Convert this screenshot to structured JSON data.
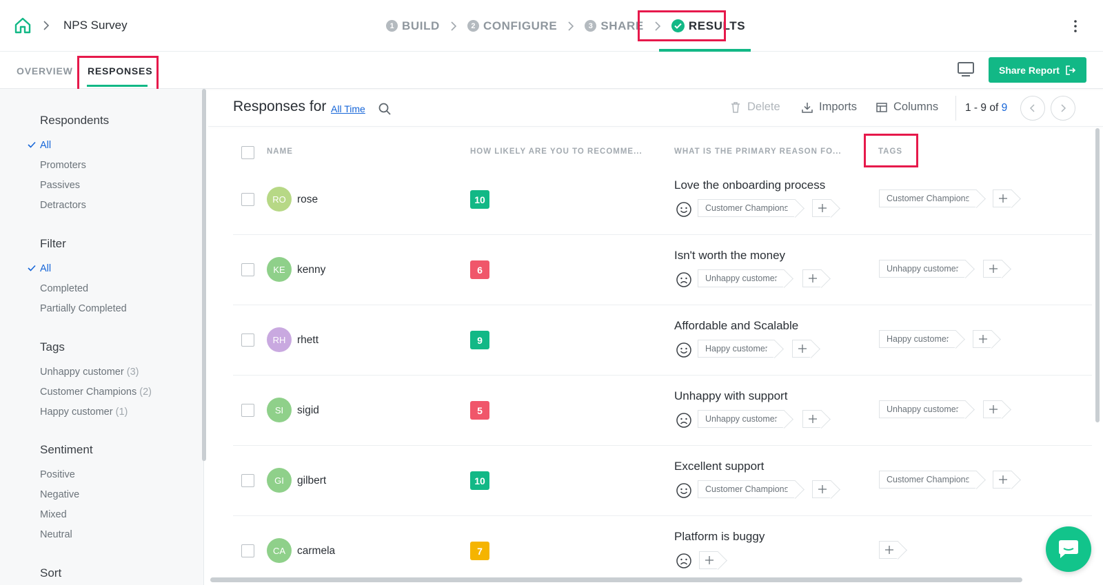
{
  "header": {
    "survey_title": "NPS Survey",
    "steps": [
      {
        "num": "1",
        "label": "BUILD"
      },
      {
        "num": "2",
        "label": "CONFIGURE"
      },
      {
        "num": "3",
        "label": "SHARE"
      },
      {
        "num": "",
        "label": "RESULTS"
      }
    ]
  },
  "subnav": {
    "tabs": [
      "OVERVIEW",
      "RESPONSES"
    ],
    "share_label": "Share Report"
  },
  "sidebar": {
    "respondents": {
      "title": "Respondents",
      "items": [
        "All",
        "Promoters",
        "Passives",
        "Detractors"
      ]
    },
    "filter": {
      "title": "Filter",
      "items": [
        "All",
        "Completed",
        "Partially Completed"
      ]
    },
    "tags": {
      "title": "Tags",
      "items": [
        {
          "label": "Unhappy customer",
          "count": "(3)"
        },
        {
          "label": "Customer Champions",
          "count": "(2)"
        },
        {
          "label": "Happy customer",
          "count": "(1)"
        }
      ]
    },
    "sentiment": {
      "title": "Sentiment",
      "items": [
        "Positive",
        "Negative",
        "Mixed",
        "Neutral"
      ]
    },
    "sort": {
      "title": "Sort"
    }
  },
  "main": {
    "title": "Responses for",
    "range_link": "All Time",
    "toolbar": {
      "delete": "Delete",
      "imports": "Imports",
      "columns": "Columns"
    },
    "pager": {
      "range": "1 - 9 of ",
      "total": "9"
    },
    "columns": [
      "NAME",
      "HOW LIKELY ARE YOU TO RECOMME...",
      "WHAT IS THE PRIMARY REASON FO...",
      "TAGS"
    ],
    "rows": [
      {
        "initials": "RO",
        "name": "rose",
        "score": "10",
        "reason": "Love the onboarding process",
        "reason_tag": "Customer Champions",
        "tag": "Customer Champions"
      },
      {
        "initials": "KE",
        "name": "kenny",
        "score": "6",
        "reason": "Isn't worth the money",
        "reason_tag": "Unhappy customer",
        "tag": "Unhappy customer"
      },
      {
        "initials": "RH",
        "name": "rhett",
        "score": "9",
        "reason": "Affordable and Scalable",
        "reason_tag": "Happy customer",
        "tag": "Happy customer"
      },
      {
        "initials": "SI",
        "name": "sigid",
        "score": "5",
        "reason": "Unhappy with support",
        "reason_tag": "Unhappy customer",
        "tag": "Unhappy customer"
      },
      {
        "initials": "GI",
        "name": "gilbert",
        "score": "10",
        "reason": "Excellent support",
        "reason_tag": "Customer Champions",
        "tag": "Customer Champions"
      },
      {
        "initials": "CA",
        "name": "carmela",
        "score": "7",
        "reason": "Platform is buggy",
        "reason_tag": "",
        "tag": ""
      }
    ]
  },
  "colors": {
    "accent": "#12b886",
    "highlight": "#e6194b",
    "link": "#1565d8",
    "promoter": "#12b886",
    "passive": "#f5b400",
    "detractor": "#f0566a"
  }
}
